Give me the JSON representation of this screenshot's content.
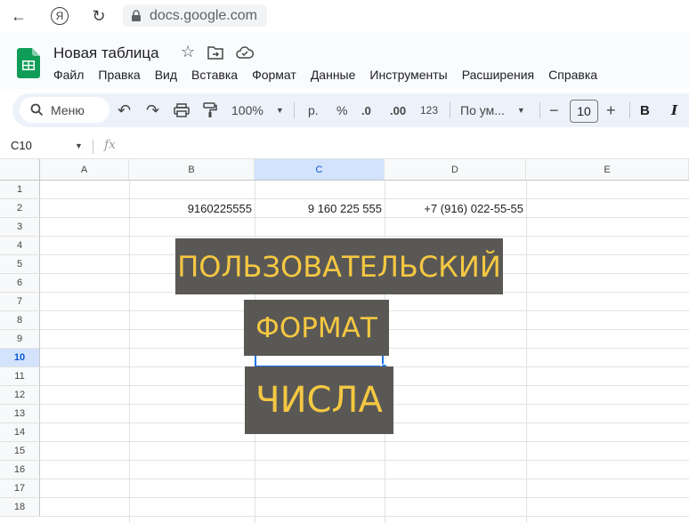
{
  "browser": {
    "url": "docs.google.com",
    "back_icon": "←",
    "yandex_icon": "Я",
    "reload_icon": "↻"
  },
  "doc": {
    "title": "Новая таблица",
    "menu": [
      "Файл",
      "Правка",
      "Вид",
      "Вставка",
      "Формат",
      "Данные",
      "Инструменты",
      "Расширения",
      "Справка"
    ]
  },
  "toolbar": {
    "search_label": "Меню",
    "zoom": "100%",
    "currency": "р.",
    "percent": "%",
    "dec_decrease": ".0",
    "dec_increase": ".00",
    "number_format": "123",
    "font": "По ум...",
    "font_size": "10",
    "minus": "−",
    "plus": "+",
    "bold": "B",
    "italic": "I"
  },
  "formula_bar": {
    "name_box": "C10",
    "fx": "fx"
  },
  "grid": {
    "columns": [
      "A",
      "B",
      "C",
      "D",
      "E"
    ],
    "rows": [
      "1",
      "2",
      "3",
      "4",
      "5",
      "6",
      "7",
      "8",
      "9",
      "10",
      "11",
      "12",
      "13",
      "14",
      "15",
      "16",
      "17",
      "18"
    ],
    "selected_column": "C",
    "selected_row": "10",
    "cells": {
      "B2": "9160225555",
      "C2": "9 160 225 555",
      "D2": "+7 (916) 022-55-55"
    }
  },
  "overlay": {
    "line1": "ПОЛЬЗОВАТЕЛЬСКИЙ",
    "line2": "ФОРМАТ",
    "line3": "ЧИСЛА",
    "bg_color": "#5a5855",
    "text_color": "#f5c842"
  },
  "colors": {
    "selection": "#1a73e8",
    "header_selected": "#d3e3fd",
    "sheets_green": "#0f9d58"
  }
}
